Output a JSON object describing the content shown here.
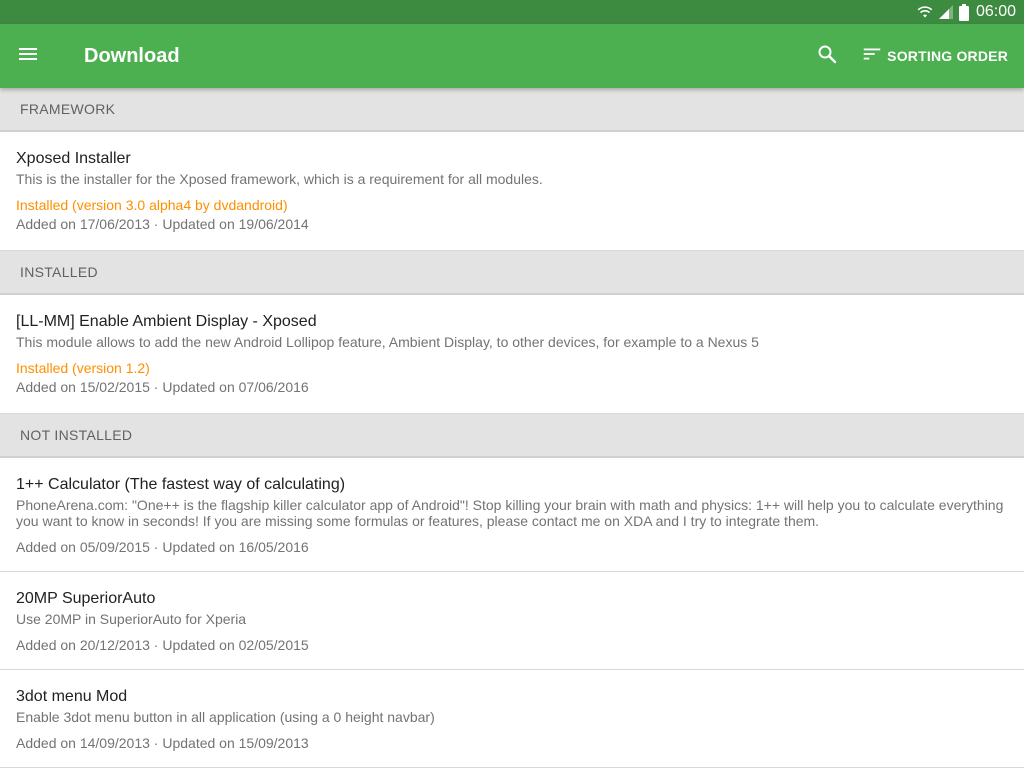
{
  "status_bar": {
    "time": "06:00",
    "icons": [
      "wifi-icon",
      "signal-icon",
      "battery-icon"
    ]
  },
  "toolbar": {
    "menu_icon": "hamburger-menu-icon",
    "title": "Download",
    "search_icon": "search-icon",
    "sort_icon": "sort-icon",
    "sort_label": "SORTING ORDER",
    "color": "#4caf50"
  },
  "sections": [
    {
      "header": "FRAMEWORK",
      "items": [
        {
          "title": "Xposed Installer",
          "description": "This is the installer for the Xposed framework, which is a requirement for all modules.",
          "status": "Installed (version 3.0 alpha4 by dvdandroid)",
          "dates": "Added on 17/06/2013 · Updated on 19/06/2014"
        }
      ]
    },
    {
      "header": "INSTALLED",
      "items": [
        {
          "title": "[LL-MM] Enable Ambient Display - Xposed",
          "description": "This module allows to add the new Android Lollipop feature, Ambient Display, to other devices, for example to a Nexus 5",
          "status": "Installed (version 1.2)",
          "dates": "Added on 15/02/2015 · Updated on 07/06/2016"
        }
      ]
    },
    {
      "header": "NOT INSTALLED",
      "items": [
        {
          "title": "1++ Calculator (The fastest way of calculating)",
          "description": "PhoneArena.com: \"One++ is the flagship killer calculator app of Android\"! Stop killing your brain with math and physics: 1++ will help you to calculate everything you want to know in seconds! If you are missing some formulas or features, please contact me on XDA and I try to integrate them.",
          "dates": "Added on 05/09/2015 · Updated on 16/05/2016"
        },
        {
          "title": "20MP SuperiorAuto",
          "description": "Use 20MP in SuperiorAuto for Xperia",
          "dates": "Added on 20/12/2013 · Updated on 02/05/2015"
        },
        {
          "title": "3dot menu Mod",
          "description": "Enable 3dot menu button in all application (using a 0 height navbar)",
          "dates": "Added on 14/09/2013 · Updated on 15/09/2013"
        }
      ]
    }
  ],
  "colors": {
    "status_bar": "#3d8b40",
    "accent_installed": "#ff8f00",
    "section_header_bg": "#e3e3e3"
  }
}
